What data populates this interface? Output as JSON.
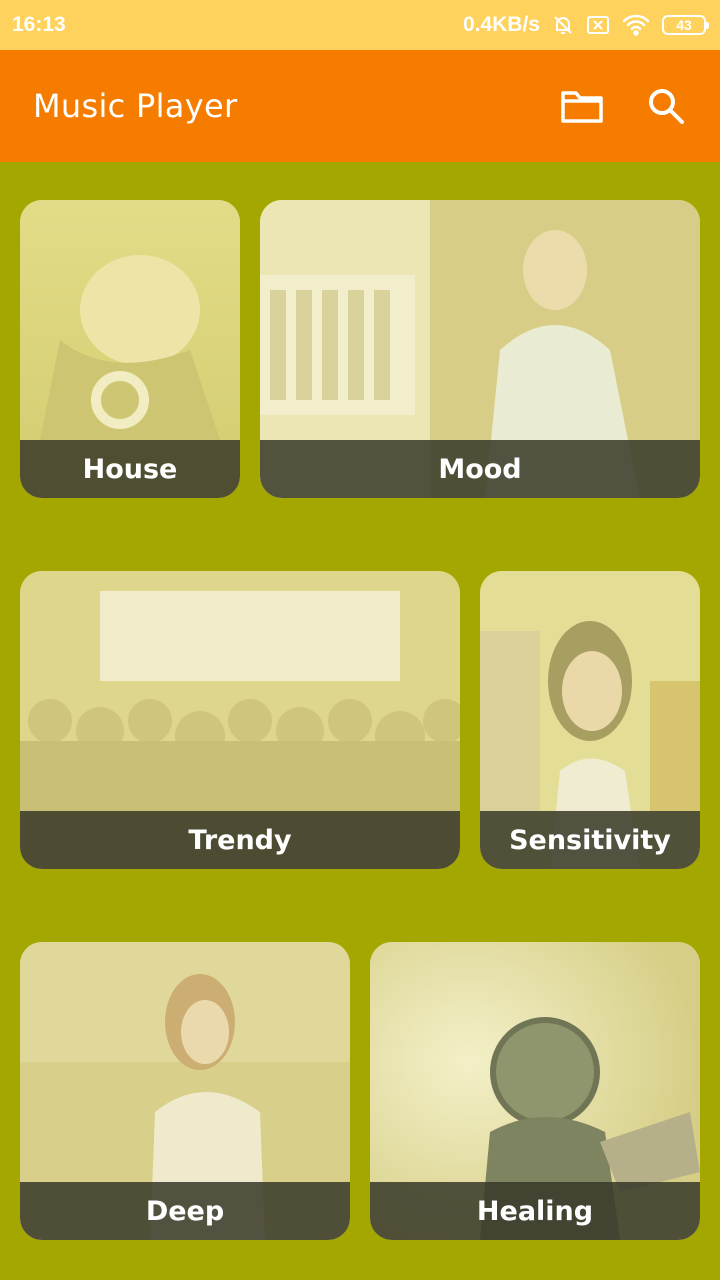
{
  "status_bar": {
    "time": "16:13",
    "net_speed": "0.4KB/s",
    "battery": "43",
    "icons": [
      "mute-bell-icon",
      "sim-x-icon",
      "wifi-icon",
      "battery-icon"
    ]
  },
  "app_bar": {
    "title": "Music Player",
    "actions": [
      "folder-icon",
      "search-icon"
    ]
  },
  "categories": [
    {
      "label": "House"
    },
    {
      "label": "Mood"
    },
    {
      "label": "Trendy"
    },
    {
      "label": "Sensitivity"
    },
    {
      "label": "Deep"
    },
    {
      "label": "Healing"
    }
  ],
  "colors": {
    "status_bar": "#ffd25e",
    "app_bar": "#f67c00",
    "background": "#a3a700",
    "card_label_bg": "#37372a"
  }
}
